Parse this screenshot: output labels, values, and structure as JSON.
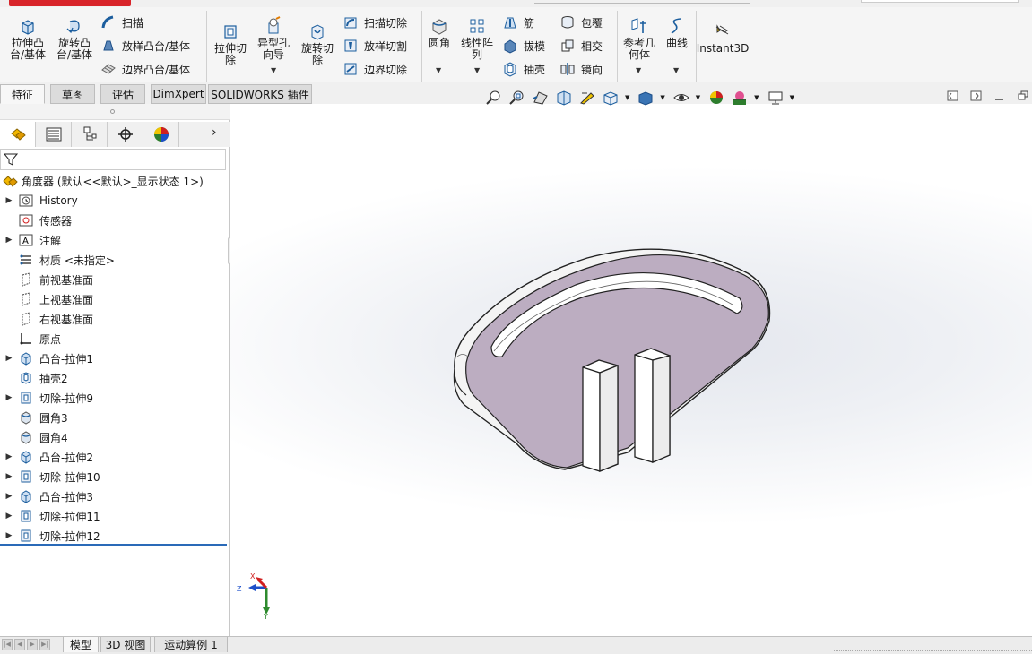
{
  "ribbon": {
    "extrude_boss": "拉伸凸\n台/基体",
    "revolve_boss": "旋转凸\n台/基体",
    "sweep": "扫描",
    "loft_boss": "放样凸台/基体",
    "boundary_boss": "边界凸台/基体",
    "extrude_cut": "拉伸切\n除",
    "hole_wizard": "异型孔\n向导",
    "revolve_cut": "旋转切\n除",
    "swept_cut": "扫描切除",
    "lofted_cut": "放样切割",
    "boundary_cut": "边界切除",
    "fillet": "圆角",
    "linear_pattern": "线性阵\n列",
    "rib": "筋",
    "draft": "拔模",
    "shell": "抽壳",
    "wrap": "包覆",
    "intersect": "相交",
    "mirror": "镜向",
    "ref_geometry": "参考几\n何体",
    "curves": "曲线",
    "instant3d": "Instant3D"
  },
  "feature_tabs": [
    "特征",
    "草图",
    "评估",
    "DimXpert",
    "SOLIDWORKS 插件"
  ],
  "tree": {
    "root": "角度器  (默认<<默认>_显示状态 1>)",
    "items": [
      {
        "label": "History",
        "expandable": true,
        "icon": "history-icon"
      },
      {
        "label": "传感器",
        "expandable": false,
        "icon": "sensor-icon"
      },
      {
        "label": "注解",
        "expandable": true,
        "icon": "annotation-icon"
      },
      {
        "label": "材质 <未指定>",
        "expandable": false,
        "icon": "material-icon"
      },
      {
        "label": "前视基准面",
        "expandable": false,
        "icon": "plane-icon"
      },
      {
        "label": "上视基准面",
        "expandable": false,
        "icon": "plane-icon"
      },
      {
        "label": "右视基准面",
        "expandable": false,
        "icon": "plane-icon"
      },
      {
        "label": "原点",
        "expandable": false,
        "icon": "origin-icon"
      },
      {
        "label": "凸台-拉伸1",
        "expandable": true,
        "icon": "boss-extrude-icon"
      },
      {
        "label": "抽壳2",
        "expandable": false,
        "icon": "shell-icon"
      },
      {
        "label": "切除-拉伸9",
        "expandable": true,
        "icon": "cut-extrude-icon"
      },
      {
        "label": "圆角3",
        "expandable": false,
        "icon": "fillet-icon"
      },
      {
        "label": "圆角4",
        "expandable": false,
        "icon": "fillet-icon"
      },
      {
        "label": "凸台-拉伸2",
        "expandable": true,
        "icon": "boss-extrude-icon"
      },
      {
        "label": "切除-拉伸10",
        "expandable": true,
        "icon": "cut-extrude-icon"
      },
      {
        "label": "凸台-拉伸3",
        "expandable": true,
        "icon": "boss-extrude-icon"
      },
      {
        "label": "切除-拉伸11",
        "expandable": true,
        "icon": "cut-extrude-icon"
      },
      {
        "label": "切除-拉伸12",
        "expandable": true,
        "icon": "cut-extrude-icon"
      }
    ]
  },
  "triad": {
    "x": "X",
    "y": "Y",
    "z": "Z"
  },
  "bottom_tabs": [
    "模型",
    "3D 视图",
    "运动算例 1"
  ],
  "colors": {
    "part_face": "#bcadc1",
    "accent": "#2a6ab8",
    "logo": "#d8242a"
  }
}
